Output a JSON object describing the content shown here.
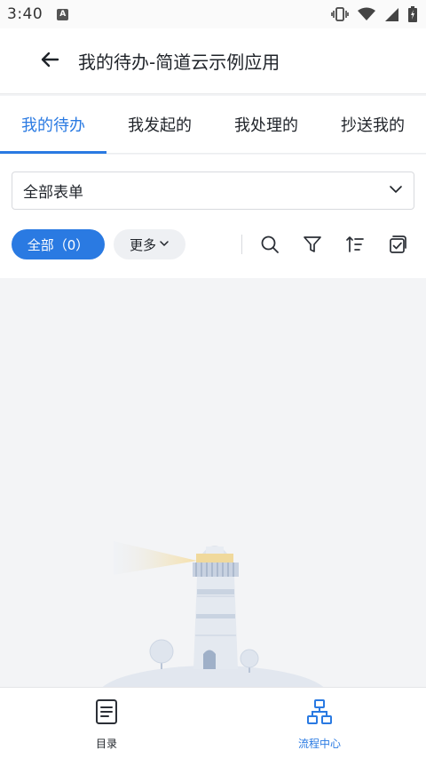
{
  "status_bar": {
    "time": "3:40",
    "icons": [
      "app-a-icon",
      "vibrate-icon",
      "wifi-icon",
      "signal-icon",
      "battery-icon"
    ]
  },
  "header": {
    "title": "我的待办-简道云示例应用",
    "back_icon": "arrow-left-icon"
  },
  "tabs": [
    {
      "label": "我的待办",
      "active": true
    },
    {
      "label": "我发起的",
      "active": false
    },
    {
      "label": "我处理的",
      "active": false
    },
    {
      "label": "抄送我的",
      "active": false
    }
  ],
  "form_select": {
    "value": "全部表单",
    "icon": "chevron-down-icon"
  },
  "toolbar": {
    "all_label": "全部（0）",
    "more_label": "更多",
    "icons": [
      "search-icon",
      "filter-icon",
      "sort-icon",
      "batch-check-icon"
    ]
  },
  "bottom_nav": [
    {
      "label": "目录",
      "icon": "document-list-icon",
      "active": false
    },
    {
      "label": "流程中心",
      "icon": "flow-chart-icon",
      "active": true
    }
  ],
  "colors": {
    "accent": "#2a7ae2",
    "background": "#f3f4f6",
    "text": "#1f2329"
  }
}
